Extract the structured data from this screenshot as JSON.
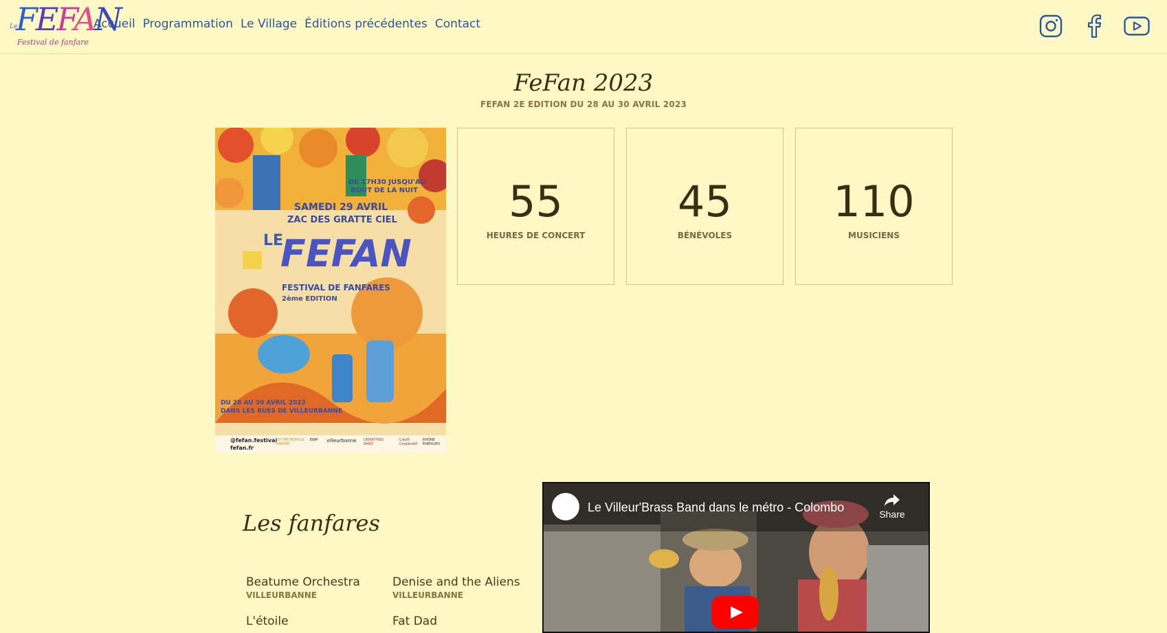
{
  "header": {
    "logo": {
      "le": "Le",
      "word": "FEFAN",
      "tagline": "Festival de fanfare"
    },
    "nav": [
      "Accueil",
      "Programmation",
      "Le Village",
      "Éditions précédentes",
      "Contact"
    ],
    "social": [
      "instagram-icon",
      "facebook-icon",
      "youtube-icon"
    ]
  },
  "hero": {
    "title": "FeFan 2023",
    "subtitle": "FEFAN 2E EDITION DU 28 AU 30 AVRIL 2023"
  },
  "poster": {
    "line1": "DE 17H30 JUSQU'AU",
    "line2": "BOUT DE LA NUIT",
    "date": "SAMEDI 29 AVRIL",
    "place": "ZAC DES GRATTE CIEL",
    "le": "LE",
    "fefan": "FEFAN",
    "festival": "FESTIVAL DE FANFARES",
    "edition": "2ème EDITION",
    "dates": "DU 28 AU 30 AVRIL 2023",
    "streets": "DANS LES RUES DE VILLEURBANNE",
    "handle": "@fefan.festival",
    "site": "fefan.fr",
    "sponsors": [
      "EST MÉTROPOLE HABITAT",
      "ENM",
      "villeurbanne",
      "DEMATHIEU BARD",
      "Crédit Coopératif",
      "RHÔNE ÉNERGIES"
    ]
  },
  "stats": [
    {
      "value": "55",
      "label": "HEURES DE CONCERT"
    },
    {
      "value": "45",
      "label": "BÉNÉVOLES"
    },
    {
      "value": "110",
      "label": "MUSICIENS"
    }
  ],
  "fanfares": {
    "title": "Les fanfares",
    "bands": [
      {
        "name": "Beatume Orchestra",
        "city": "VILLEURBANNE"
      },
      {
        "name": "Denise and the Aliens",
        "city": "VILLEURBANNE"
      },
      {
        "name": "L'étoile",
        "city": ""
      },
      {
        "name": "Fat Dad",
        "city": ""
      }
    ]
  },
  "video": {
    "title": "Le Villeur'Brass Band dans le métro - Colombo",
    "share": "Share"
  },
  "colors": {
    "background": "#fdf8c4",
    "nav_link": "#27559e",
    "youtube_red": "#ff0000",
    "stat_border": "#cfc28d"
  }
}
